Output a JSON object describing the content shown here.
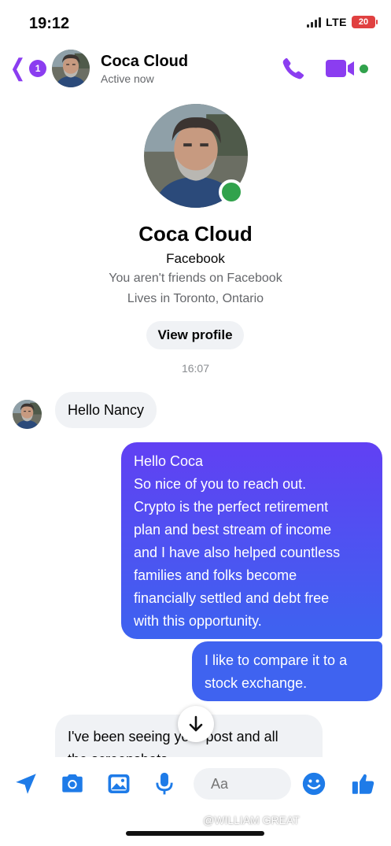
{
  "status_bar": {
    "time": "19:12",
    "network": "LTE",
    "battery": "20"
  },
  "header": {
    "back_badge": "1",
    "name": "Coca Cloud",
    "status": "Active now"
  },
  "profile": {
    "name": "Coca Cloud",
    "platform": "Facebook",
    "friend_status": "You aren't friends on Facebook",
    "location": "Lives in Toronto, Ontario",
    "view_profile_label": "View profile"
  },
  "conversation": {
    "timestamp": "16:07",
    "messages": [
      {
        "direction": "incoming",
        "text": "Hello Nancy"
      },
      {
        "direction": "outgoing",
        "lines": [
          "Hello Coca",
          "So nice of you to reach out.",
          "Crypto is the perfect retirement",
          "plan and best stream of income",
          "and I have also helped countless",
          "families and folks become",
          "financially settled and debt free",
          "with this opportunity."
        ]
      },
      {
        "direction": "outgoing",
        "lines": [
          "I like to compare it to a",
          "stock exchange."
        ]
      },
      {
        "direction": "incoming",
        "lines": [
          "I've been seeing your post and all",
          "the screenshots"
        ]
      }
    ]
  },
  "composer": {
    "placeholder": "Aa"
  },
  "watermark": "@WILLIAM GREAT",
  "colors": {
    "accent": "#8b3df0",
    "outgoing_bubble_top": "#6140f3",
    "outgoing_bubble_bottom": "#3d63f0",
    "incoming_bubble": "#f0f2f5",
    "online": "#31a24c",
    "composer_icon": "#1e7be8"
  },
  "icons": {
    "back": "chevron-left-icon",
    "call": "phone-icon",
    "video": "video-camera-icon",
    "location": "location-arrow-icon",
    "camera": "camera-icon",
    "gallery": "image-icon",
    "microphone": "microphone-icon",
    "emoji": "emoji-icon",
    "like": "thumbs-up-icon",
    "scroll": "arrow-down-icon"
  }
}
